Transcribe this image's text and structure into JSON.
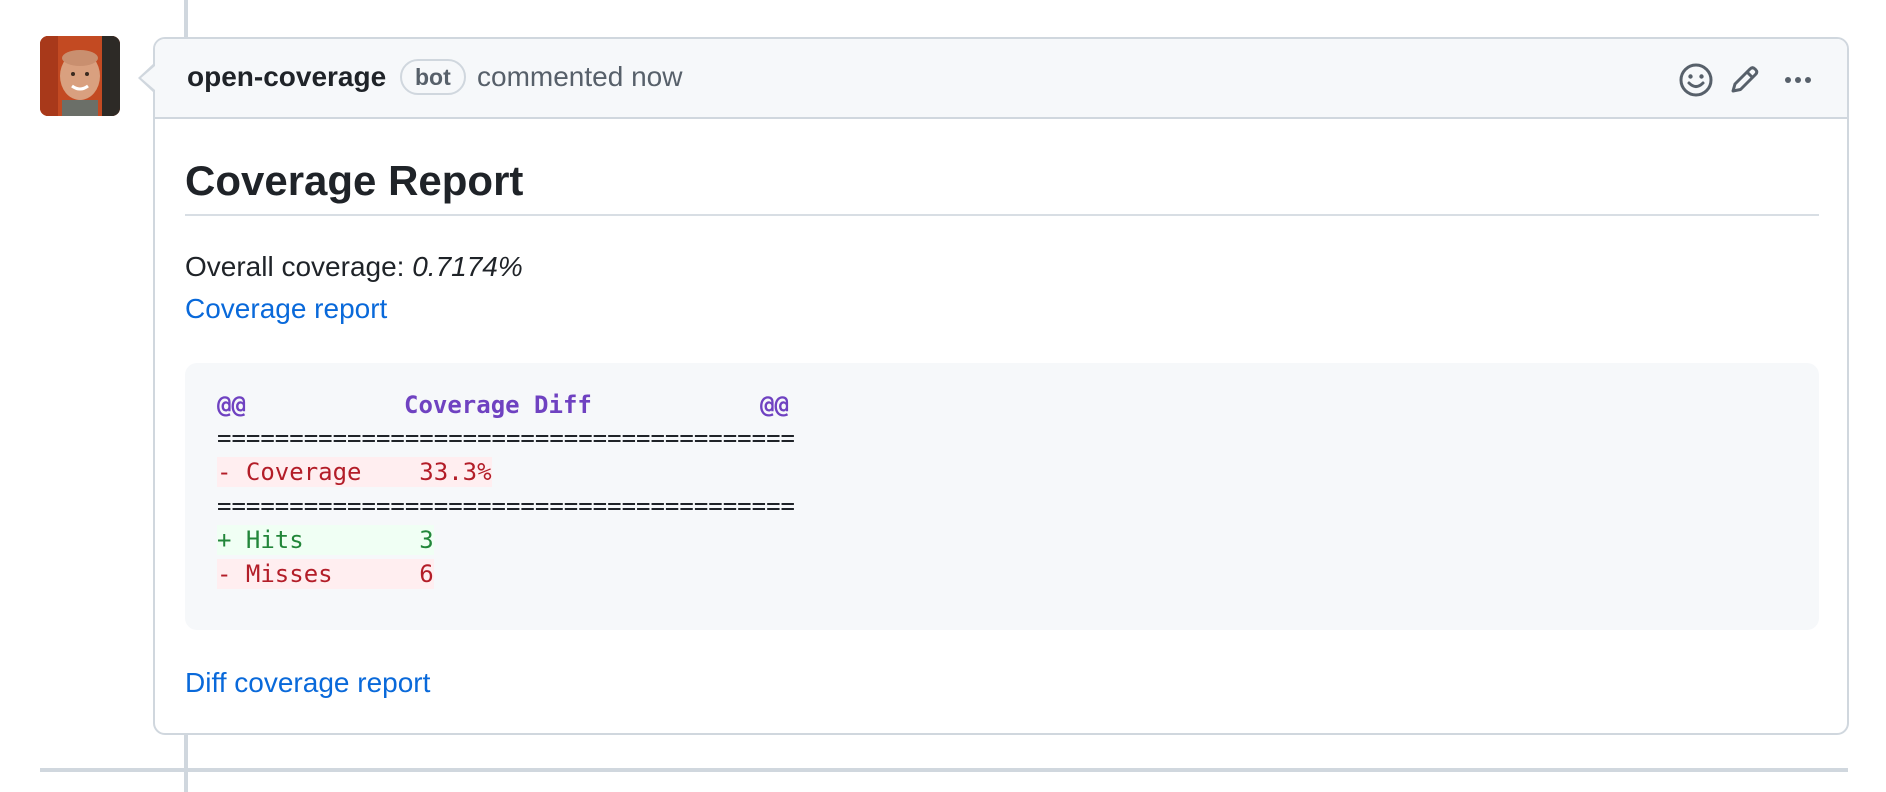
{
  "comment": {
    "author": "open-coverage",
    "badge": "bot",
    "meta": "commented now",
    "icons": [
      "smiley-icon",
      "pencil-icon",
      "kebab-horizontal-icon"
    ]
  },
  "body": {
    "title": "Coverage Report",
    "overall_label": "Overall coverage: ",
    "overall_value": "0.7174%",
    "coverage_link": "Coverage report",
    "diff_link": "Diff coverage report"
  },
  "code": {
    "header_left": "@@",
    "header_title": "Coverage Diff",
    "header_right": "@@",
    "separator": "========================================",
    "coverage_line": "- Coverage    33.3%",
    "hits_line": "+ Hits        3",
    "misses_line": "- Misses      6"
  },
  "colors": {
    "link": "#0969da",
    "added": "#22863a",
    "removed": "#b31d28",
    "diff_header": "#6f42c1"
  }
}
